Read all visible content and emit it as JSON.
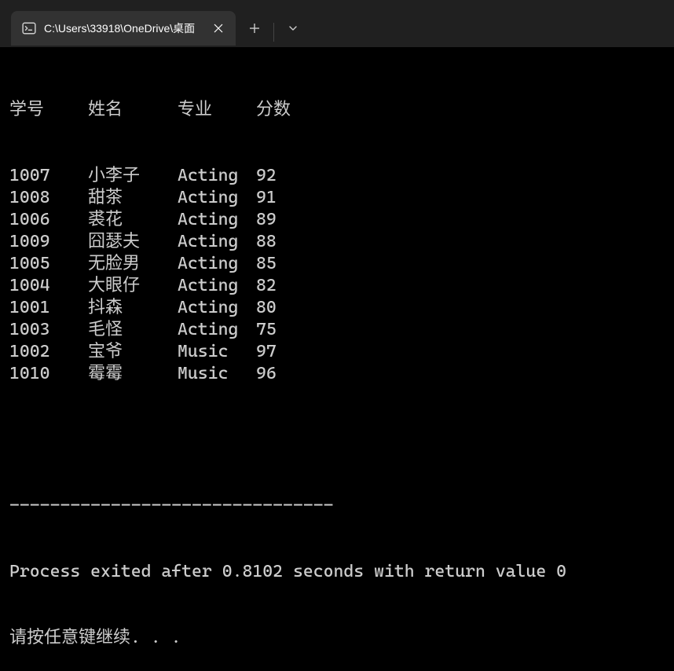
{
  "tab": {
    "title": "C:\\Users\\33918\\OneDrive\\桌面"
  },
  "headers": {
    "id": "学号",
    "name": "姓名",
    "major": "专业",
    "score": "分数"
  },
  "rows": [
    {
      "id": "1007",
      "name": "小李子",
      "major": "Acting",
      "score": "92"
    },
    {
      "id": "1008",
      "name": "甜茶",
      "major": "Acting",
      "score": "91"
    },
    {
      "id": "1006",
      "name": "裘花",
      "major": "Acting",
      "score": "89"
    },
    {
      "id": "1009",
      "name": "囧瑟夫",
      "major": "Acting",
      "score": "88"
    },
    {
      "id": "1005",
      "name": "无脸男",
      "major": "Acting",
      "score": "85"
    },
    {
      "id": "1004",
      "name": "大眼仔",
      "major": "Acting",
      "score": "82"
    },
    {
      "id": "1001",
      "name": "抖森",
      "major": "Acting",
      "score": "80"
    },
    {
      "id": "1003",
      "name": "毛怪",
      "major": "Acting",
      "score": "75"
    },
    {
      "id": "1002",
      "name": "宝爷",
      "major": "Music",
      "score": "97"
    },
    {
      "id": "1010",
      "name": "霉霉",
      "major": "Music",
      "score": "96"
    }
  ],
  "separator": "--------------------------------",
  "exit_msg": "Process exited after 0.8102 seconds with return value 0",
  "prompt": "请按任意键继续. . ."
}
